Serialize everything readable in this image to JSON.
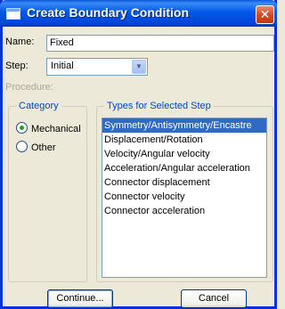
{
  "window": {
    "title": "Create Boundary Condition",
    "close_glyph": "✕"
  },
  "form": {
    "name_label": "Name:",
    "name_value": "Fixed",
    "step_label": "Step:",
    "step_value": "Initial",
    "procedure_label": "Procedure:"
  },
  "category": {
    "legend": "Category",
    "options": [
      {
        "label": "Mechanical",
        "checked": true
      },
      {
        "label": "Other",
        "checked": false
      }
    ]
  },
  "types": {
    "legend": "Types for Selected Step",
    "items": [
      {
        "label": "Symmetry/Antisymmetry/Encastre",
        "selected": true
      },
      {
        "label": "Displacement/Rotation",
        "selected": false
      },
      {
        "label": "Velocity/Angular velocity",
        "selected": false
      },
      {
        "label": "Acceleration/Angular acceleration",
        "selected": false
      },
      {
        "label": "Connector displacement",
        "selected": false
      },
      {
        "label": "Connector velocity",
        "selected": false
      },
      {
        "label": "Connector acceleration",
        "selected": false
      }
    ]
  },
  "buttons": {
    "continue_label": "Continue...",
    "cancel_label": "Cancel"
  },
  "icons": {
    "window_icon": "window-icon",
    "close_icon": "close-icon",
    "dropdown_icon": "chevron-down-icon"
  },
  "colors": {
    "titlebar": "#0058e6",
    "selection": "#316ac5",
    "group_legend": "#0046d5",
    "background": "#ece9d8"
  }
}
